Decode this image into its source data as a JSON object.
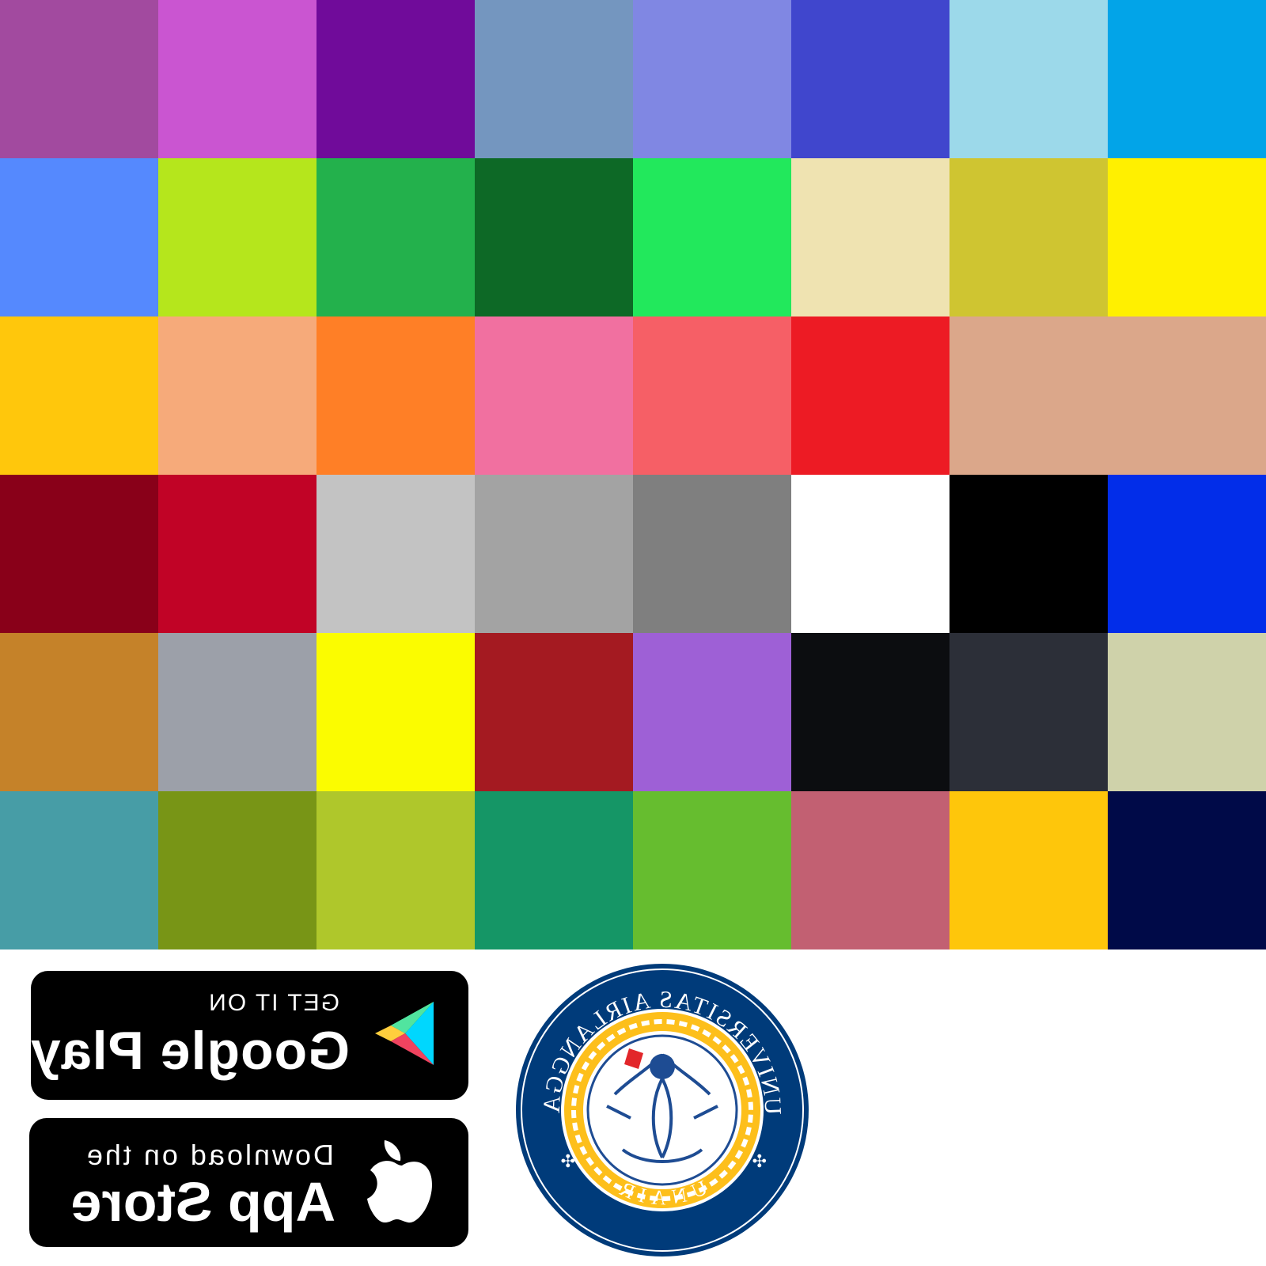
{
  "palette": [
    "#a24a9f",
    "#ca55d1",
    "#700b9a",
    "#7496bf",
    "#8087e3",
    "#4046cd",
    "#9cd9ea",
    "#02a4e8",
    "#5589fe",
    "#b5e61c",
    "#23b14c",
    "#0d6926",
    "#22e85c",
    "#efe3b1",
    "#cfc531",
    "#fff000",
    "#ffc70c",
    "#f6aa7a",
    "#ff7f26",
    "#f170a0",
    "#f65f66",
    "#ed1b24",
    "#dba78a",
    "#dba78a",
    "#890019",
    "#c10326",
    "#c3c3c3",
    "#a3a3a3",
    "#7f7f7f",
    "#ffffff",
    "#000000",
    "#022de9",
    "#c58229",
    "#9ca0a9",
    "#fbfc00",
    "#a41a21",
    "#9e60d6",
    "#0c0d10",
    "#2c2f38",
    "#cfd2aa",
    "#479da6",
    "#789516",
    "#afc72b",
    "#159666",
    "#66bd2f",
    "#c26072",
    "#fec60b",
    "#000a48"
  ],
  "badges": {
    "google_play": {
      "small": "GET IT ON",
      "big": "Google Play"
    },
    "app_store": {
      "small": "Download on the",
      "big": "App Store"
    }
  },
  "seal": {
    "top_text": "UNIVERSITAS AIRLANGGA",
    "bottom_text": "UNAIR",
    "colors": {
      "ring": "#003b7a",
      "gold": "#fdbf1b",
      "inner": "#1e4c93"
    }
  }
}
